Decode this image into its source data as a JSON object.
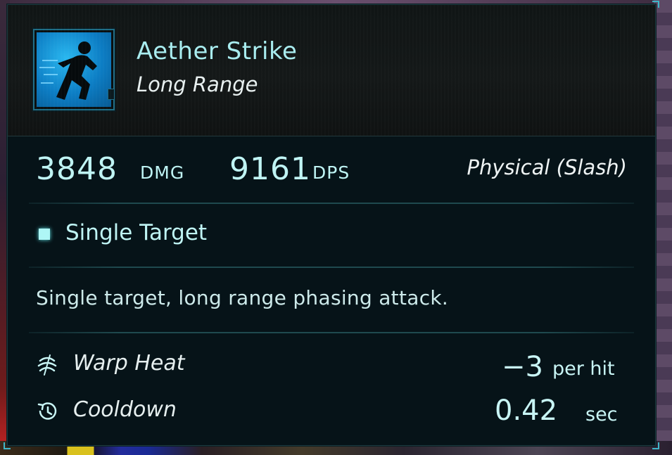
{
  "ability": {
    "name": "Aether Strike",
    "range": "Long Range",
    "icon": "running-figure-icon",
    "icon_color": "#1a9ee0"
  },
  "stats": {
    "damage_value": "3848",
    "damage_unit": "DMG",
    "dps_value": "9161",
    "dps_unit": "DPS",
    "damage_type": "Physical (Slash)"
  },
  "targeting": {
    "label": "Single Target"
  },
  "description": "Single target, long range phasing attack.",
  "properties": {
    "warp_heat": {
      "label": "Warp Heat",
      "value": "−3",
      "unit": "per hit",
      "icon": "warp-heat-icon"
    },
    "cooldown": {
      "label": "Cooldown",
      "value": "0.42",
      "unit": "sec",
      "icon": "cooldown-icon"
    }
  },
  "colors": {
    "accent": "#bff4f4",
    "panel_bg": "#061318",
    "divider": "#1f4a4f"
  }
}
